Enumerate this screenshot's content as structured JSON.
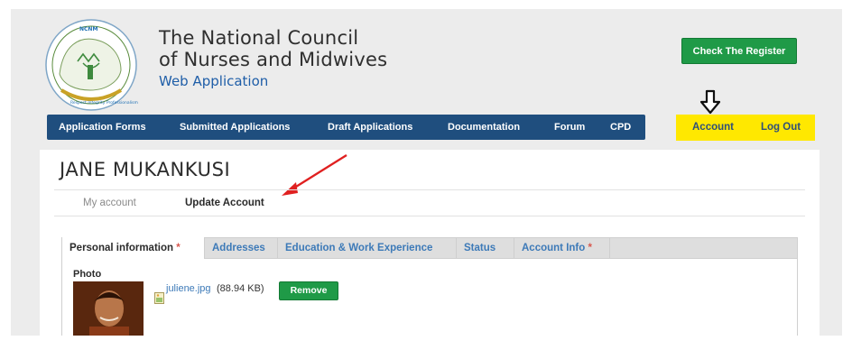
{
  "header": {
    "logo_name": "ncnm-logo",
    "logo_badge_text": "NCNM",
    "logo_motto": "Respect Integrity Professionalism",
    "brand_line1": "The National Council",
    "brand_line2": "of Nurses and Midwives",
    "brand_line3": "Web Application",
    "register_button": "Check The Register"
  },
  "nav": {
    "items": [
      {
        "label": "Application Forms"
      },
      {
        "label": "Submitted Applications"
      },
      {
        "label": "Draft Applications"
      },
      {
        "label": "Documentation"
      },
      {
        "label": "Forum"
      },
      {
        "label": "CPD"
      }
    ],
    "account": "Account",
    "logout": "Log Out"
  },
  "page": {
    "title": "JANE MUKANKUSI",
    "subtabs": [
      {
        "label": "My account"
      },
      {
        "label": "Update Account"
      }
    ]
  },
  "form": {
    "tabs": [
      {
        "label": "Personal information",
        "required_mark": "*"
      },
      {
        "label": "Addresses"
      },
      {
        "label": "Education & Work Experience"
      },
      {
        "label": "Status"
      },
      {
        "label": "Account Info",
        "required_mark": "*"
      }
    ],
    "photo_label": "Photo",
    "file_name": "juliene.jpg",
    "file_size": "(88.94 KB)",
    "remove_button": "Remove"
  },
  "colors": {
    "nav_bg": "#1f4e7e",
    "highlight_yellow": "#ffe800",
    "button_green": "#1f9a47",
    "link_blue": "#3d7ab8",
    "annotation_red": "#e02020"
  }
}
